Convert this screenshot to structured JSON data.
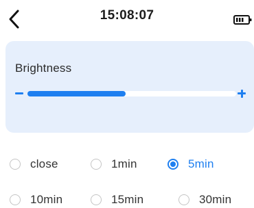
{
  "status_bar": {
    "time": "15:08:07",
    "back_icon": "chevron-left-icon",
    "battery_icon": "battery-icon"
  },
  "brightness": {
    "title": "Brightness",
    "level_fraction": 0.47,
    "minus_icon": "minus-icon",
    "plus_icon": "plus-icon"
  },
  "timeout_options": [
    {
      "label": "close",
      "selected": false
    },
    {
      "label": "1min",
      "selected": false
    },
    {
      "label": "5min",
      "selected": true
    },
    {
      "label": "10min",
      "selected": false
    },
    {
      "label": "15min",
      "selected": false
    },
    {
      "label": "30min",
      "selected": false
    }
  ],
  "colors": {
    "accent": "#1e7ff0",
    "card_background": "#e6effc",
    "radio_border": "#c4c4c4"
  }
}
